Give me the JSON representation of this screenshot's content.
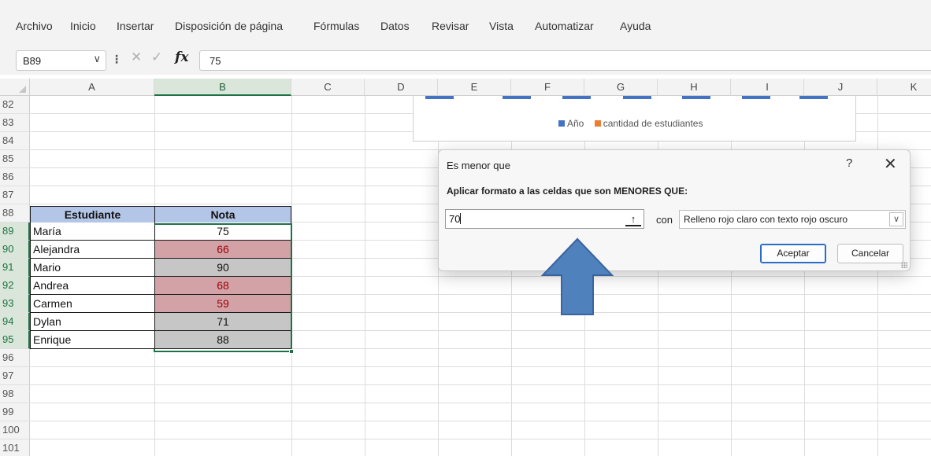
{
  "menu": [
    "Archivo",
    "Inicio",
    "Insertar",
    "Disposición de página",
    "Fórmulas",
    "Datos",
    "Revisar",
    "Vista",
    "Automatizar",
    "Ayuda"
  ],
  "formula_bar": {
    "name_box": "B89",
    "formula_value": "75",
    "icons": [
      "chevron-down-icon",
      "more-icon",
      "cancel-icon",
      "check-icon",
      "fx-icon"
    ]
  },
  "columns": [
    "A",
    "B",
    "C",
    "D",
    "E",
    "F",
    "G",
    "H",
    "I",
    "J",
    "K"
  ],
  "selected_column": "B",
  "rows": [
    "82",
    "83",
    "84",
    "85",
    "86",
    "87",
    "88",
    "89",
    "90",
    "91",
    "92",
    "93",
    "94",
    "95",
    "96",
    "97",
    "98",
    "99",
    "100",
    "101"
  ],
  "table": {
    "headers": [
      "Estudiante",
      "Nota"
    ],
    "header_color": "#b4c6e7",
    "rows": [
      {
        "name": "María",
        "score": "75",
        "highlight": false
      },
      {
        "name": "Alejandra",
        "score": "66",
        "highlight": true
      },
      {
        "name": "Mario",
        "score": "90",
        "highlight": false
      },
      {
        "name": "Andrea",
        "score": "68",
        "highlight": true
      },
      {
        "name": "Carmen",
        "score": "59",
        "highlight": true
      },
      {
        "name": "Dylan",
        "score": "71",
        "highlight": false
      },
      {
        "name": "Enrique",
        "score": "88",
        "highlight": false
      }
    ],
    "highlight_fill": "#d3a2a6",
    "highlight_text_color": "#9c0006",
    "normal_fill": "#c6c6c6"
  },
  "chart_legend": [
    {
      "label": "Año",
      "color": "#4472c4"
    },
    {
      "label": "cantidad de estudiantes",
      "color": "#ed7d31"
    }
  ],
  "dialog": {
    "title": "Es menor que",
    "help": "?",
    "close": "✕",
    "instruction": "Aplicar formato a las celdas que son MENORES QUE:",
    "input_value": "70",
    "connector": "con",
    "format_option": "Relleno rojo claro con texto rojo oscuro",
    "ok_label": "Aceptar",
    "cancel_label": "Cancelar"
  },
  "annotation_arrow_color": "#4f81bd"
}
